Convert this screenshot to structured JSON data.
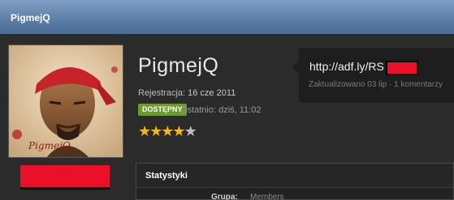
{
  "topbar": {
    "title": "PigmejQ"
  },
  "profile": {
    "username": "PigmejQ",
    "registration_label": "Rejestracja:",
    "registration_date": "16 cze 2011",
    "status_badge": "DOSTĘPNY",
    "last_seen": "Ostatnio: dziś, 11:02",
    "rating": 4,
    "rating_max": 5,
    "avatar_signature": "PigmejQ"
  },
  "status_update": {
    "text": "http://adf.ly/RS",
    "meta": "Zaktualizowano 03 lip · 1 komentarzy"
  },
  "stats": {
    "header": "Statystyki",
    "rows": [
      {
        "label": "Grupa:",
        "value": "Members"
      }
    ]
  },
  "colors": {
    "topbar": "#6384ae",
    "badge": "#6d9a2f",
    "star": "#f3b61d",
    "redaction": "#ec0f2a"
  }
}
